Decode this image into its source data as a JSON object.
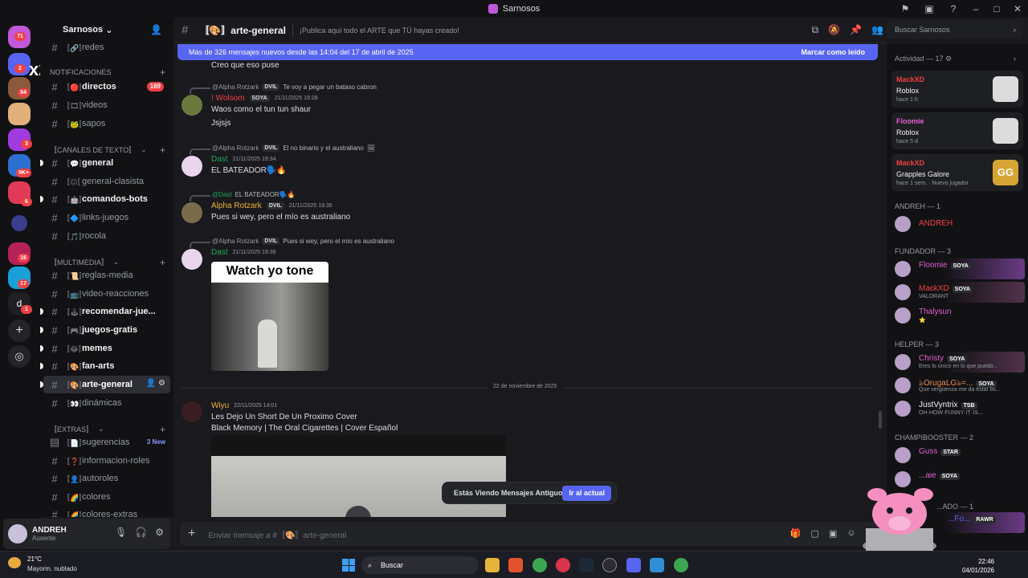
{
  "window": {
    "title": "Sarnosos"
  },
  "server": {
    "name": "Sarnosos"
  },
  "rail_badges": [
    "84",
    "3",
    "9K+",
    "6",
    "16",
    "17",
    "1",
    "2",
    "71"
  ],
  "rail_letter": "d",
  "rail_overlay": "x2",
  "channels": {
    "top_item": "redes",
    "cat_notif": "NOTIFICACIONES",
    "notif": [
      {
        "label": "directos",
        "badge": "169"
      },
      {
        "label": "videos"
      },
      {
        "label": "sapos"
      }
    ],
    "cat_texto": "〚CANALES DE TEXTO〛",
    "texto": [
      {
        "label": "general"
      },
      {
        "label": "general-clasista"
      },
      {
        "label": "comandos-bots"
      },
      {
        "label": "links-juegos"
      },
      {
        "label": "rocola"
      }
    ],
    "cat_multi": "〚MULTIMEDIA〛",
    "multi": [
      {
        "label": "reglas-media"
      },
      {
        "label": "video-reacciones"
      },
      {
        "label": "recomendar-jue..."
      },
      {
        "label": "juegos-gratis"
      },
      {
        "label": "memes"
      },
      {
        "label": "fan-arts"
      },
      {
        "label": "arte-general"
      },
      {
        "label": "dinámicas"
      }
    ],
    "cat_extras": "〚EXTRAS〛",
    "extras": [
      {
        "label": "sugerencias",
        "new": "3 New"
      },
      {
        "label": "informacion-roles"
      },
      {
        "label": "autoroles"
      },
      {
        "label": "colores"
      },
      {
        "label": "colores-extras"
      }
    ]
  },
  "user": {
    "name": "ANDREH",
    "status": "Ausente"
  },
  "header": {
    "channel": "〚🎨〛arte-general",
    "topic": "¡Publica aquí todo el ARTE que TÚ hayas creado!"
  },
  "search": {
    "placeholder": "Buscar Sarnosos"
  },
  "new_messages": {
    "text": "Más de 326 mensajes nuevos desde las 14:04 del 17 de abril de 2025",
    "action": "Marcar como leído"
  },
  "messages": {
    "m0_text": "Creo que eso puse",
    "m1_reply_name": "@Alpha Rotzark",
    "m1_reply_tag": "DVIL",
    "m1_reply_text": "Te voy a pegar un bataso cabron",
    "m1_author": "! Wolsom",
    "m1_tag": "SOYA",
    "m1_time": "21/11/2025 19:28",
    "m1_line1": "Waos como el tun tun shaur",
    "m1_line2": "Jsjsjs",
    "m2_reply_name": "@Alpha Rotzark",
    "m2_reply_tag": "DVIL",
    "m2_reply_text": "El no binario y el australiano",
    "m2_author": "Dast",
    "m2_time": "21/11/2025 19:34",
    "m2_text": "EL BATEADOR🗣️🔥",
    "m3_reply_name": "@Dast",
    "m3_reply_text": "EL BATEADOR🗣️🔥",
    "m3_author": "Alpha Rotzark",
    "m3_tag": "DVIL",
    "m3_time": "21/11/2025 19:35",
    "m3_text": "Pues si wey, pero el mío es australiano",
    "m4_reply_name": "@Alpha Rotzark",
    "m4_reply_tag": "DVIL",
    "m4_reply_text": "Pues si wey, pero el mío es australiano",
    "m4_author": "Dast",
    "m4_time": "21/11/2025 19:36",
    "m4_gif_caption": "Watch yo tone",
    "date_divider": "22 de noviembre de 2025",
    "m5_author": "Wiyu",
    "m5_time": "22/11/2025 14:01",
    "m5_line1": "Les Dejo Un Short De Un Proximo Cover",
    "m5_line2": "Black Memory | The Oral Cigarettes | Cover Español"
  },
  "old_toast": {
    "text": "Estás Viendo Mensajes Antiguos",
    "action": "Ir al actual"
  },
  "composer": {
    "placeholder": "Enviar mensaje a #〚🎨〛arte-general"
  },
  "members": {
    "activity_header": "Actividad — 17 ⚙",
    "activity": [
      {
        "who": "MackXD",
        "game": "Roblox",
        "when": "hace 1 h"
      },
      {
        "who": "Floomie",
        "game": "Roblox",
        "when": "hace 5 d"
      },
      {
        "who": "MackXD",
        "game": "Grapples Galore",
        "when": "hace 1 sem. · Nuevo jugador",
        "icon": "GG"
      }
    ],
    "cat_andreh": "ANDREH — 1",
    "andreh": "ANDREH",
    "cat_fundador": "FUNDADOR — 3",
    "fundador": [
      {
        "name": "Floomie",
        "tag": "SOYA",
        "status": "",
        "color": "#e05fd2"
      },
      {
        "name": "MackXD",
        "tag": "SOYA",
        "status": "VALORANT",
        "color": "#f23f43"
      },
      {
        "name": "Thalysun",
        "tag": "",
        "status": "⭐",
        "color": "#e05fd2"
      }
    ],
    "cat_helper": "HELPER — 3",
    "helper": [
      {
        "name": "Christy",
        "tag": "SOYA",
        "status": "Eres lo único en lo que puedo...",
        "color": "#e05fd2"
      },
      {
        "name": "ঌOrugaLGঌ=...",
        "tag": "SOYA",
        "status": "Que vergüenza me da estar llo...",
        "color": "#e58c52"
      },
      {
        "name": "JustVyntrix",
        "tag": "TSB",
        "status": "OH·HOW·FUNNY·IT·IS...",
        "color": "#f2f3f5"
      }
    ],
    "cat_champi": "CHAMPIBOOSTER — 2",
    "champi": [
      {
        "name": "Guss",
        "tag": "STAR",
        "color": "#e05fd2"
      },
      {
        "name": "...aie",
        "tag": "SOYA",
        "color": "#e05fd2"
      }
    ],
    "cat_last": "...ADO — 1",
    "last": {
      "name": "...Fo...",
      "tag": "RAWR"
    }
  },
  "taskbar": {
    "temp": "21°C",
    "weather": "Mayorm. nublado",
    "search": "Buscar",
    "time": "22:46",
    "date": "04/01/2026"
  },
  "colors": {
    "accent": "#5865f2",
    "danger": "#f23f43",
    "pink": "#e05fd2",
    "link_green": "#23a55a"
  }
}
